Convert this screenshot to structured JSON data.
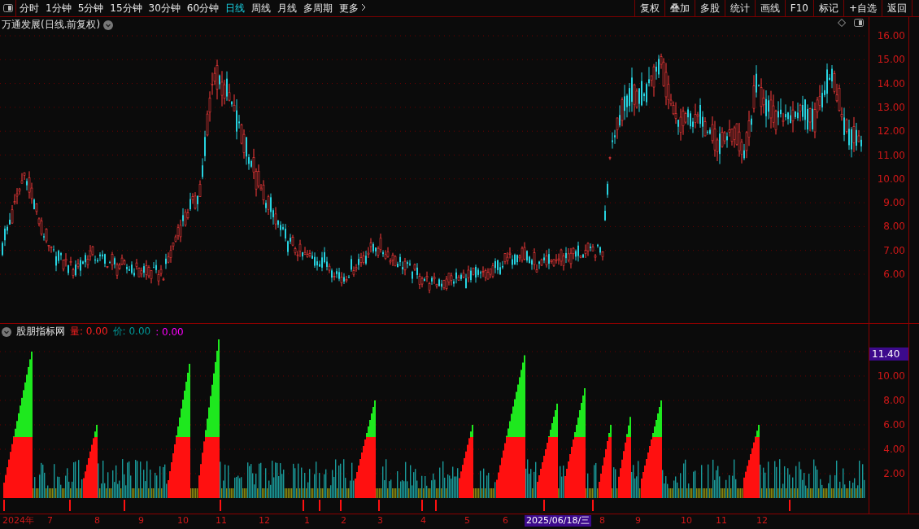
{
  "toolbar": {
    "periods": [
      {
        "label": "分时",
        "selected": false
      },
      {
        "label": "1分钟",
        "selected": false
      },
      {
        "label": "5分钟",
        "selected": false
      },
      {
        "label": "15分钟",
        "selected": false
      },
      {
        "label": "30分钟",
        "selected": false
      },
      {
        "label": "60分钟",
        "selected": false
      },
      {
        "label": "日线",
        "selected": true
      },
      {
        "label": "周线",
        "selected": false
      },
      {
        "label": "月线",
        "selected": false
      },
      {
        "label": "多周期",
        "selected": false
      }
    ],
    "more": "更多",
    "actions": [
      "复权",
      "叠加",
      "多股",
      "统计",
      "画线",
      "F10",
      "标记",
      "+自选",
      "返回"
    ]
  },
  "price_chart": {
    "title": "万通发展(日线.前复权)",
    "y_ticks": [
      "16.00",
      "15.00",
      "14.00",
      "13.00",
      "12.00",
      "11.00",
      "10.00",
      "9.00",
      "8.00",
      "7.00",
      "6.00"
    ]
  },
  "indicator": {
    "name": "股朋指标网",
    "legend": [
      {
        "label": "量:",
        "value": "0.00",
        "color": "#ff2020"
      },
      {
        "label": "价:",
        "value": "0.00",
        "color": "#009a9a"
      },
      {
        "label": ":",
        "value": "0.00",
        "color": "#ff00ff"
      }
    ],
    "current_value": "11.40",
    "y_ticks": [
      "10.00",
      "8.00",
      "6.00",
      "4.00",
      "2.00"
    ]
  },
  "time_axis": {
    "labels": [
      {
        "text": "2024年",
        "selected": false
      },
      {
        "text": "7",
        "selected": false
      },
      {
        "text": "8",
        "selected": false
      },
      {
        "text": "9",
        "selected": false
      },
      {
        "text": "10",
        "selected": false
      },
      {
        "text": "11",
        "selected": false
      },
      {
        "text": "12",
        "selected": false
      },
      {
        "text": "1",
        "selected": false
      },
      {
        "text": "2",
        "selected": false
      },
      {
        "text": "3",
        "selected": false
      },
      {
        "text": "4",
        "selected": false
      },
      {
        "text": "5",
        "selected": false
      },
      {
        "text": "6",
        "selected": false
      },
      {
        "text": "2025/06/18/三",
        "selected": true
      },
      {
        "text": "8",
        "selected": false
      },
      {
        "text": "9",
        "selected": false
      },
      {
        "text": "10",
        "selected": false
      },
      {
        "text": "11",
        "selected": false
      },
      {
        "text": "12",
        "selected": false
      }
    ]
  }
}
